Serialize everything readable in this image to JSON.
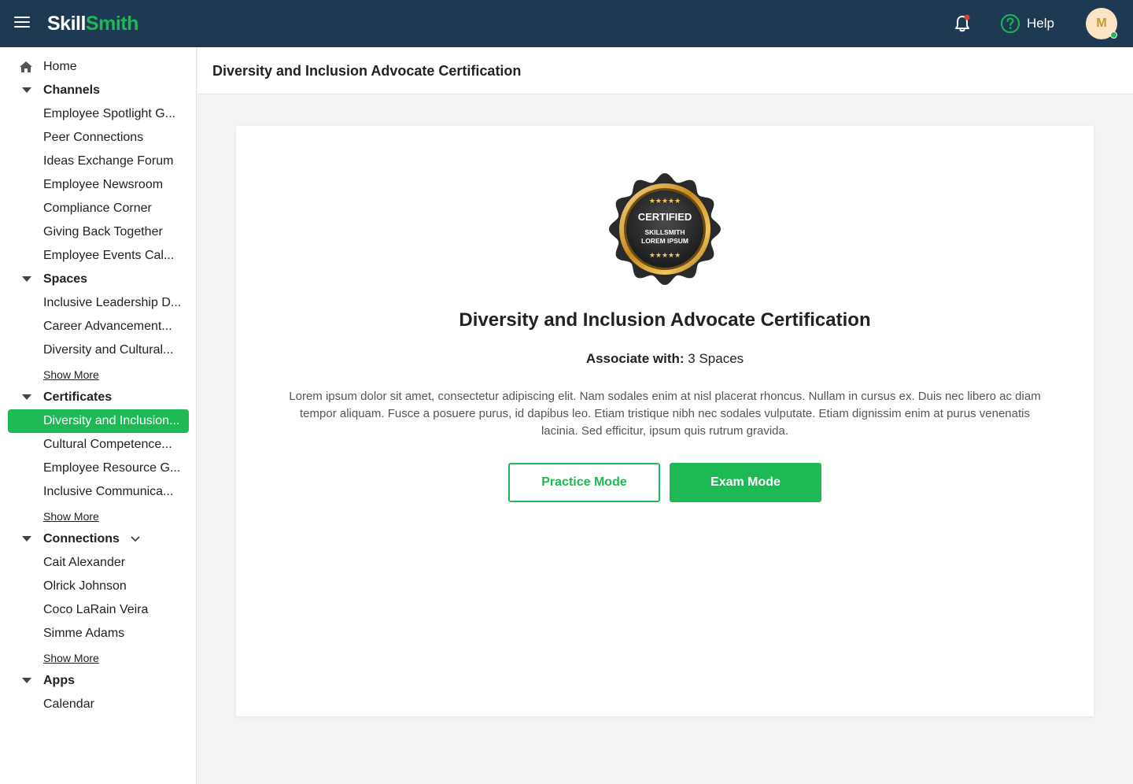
{
  "app": {
    "logo_part1": "Skill",
    "logo_part2": "Smith",
    "help_label": "Help",
    "avatar_initial": "M",
    "brand_color": "#1db954",
    "topbar_color": "#1e3a52"
  },
  "sidebar": {
    "home": "Home",
    "channels": {
      "label": "Channels",
      "items": [
        "Employee Spotlight G...",
        "Peer Connections",
        "Ideas Exchange Forum",
        "Employee Newsroom",
        "Compliance Corner",
        "Giving Back Together",
        "Employee Events Cal..."
      ]
    },
    "spaces": {
      "label": "Spaces",
      "items": [
        "Inclusive Leadership D...",
        "Career Advancement...",
        "Diversity and Cultural..."
      ],
      "show_more": "Show More"
    },
    "certificates": {
      "label": "Certificates",
      "items": [
        "Diversity and Inclusion...",
        "Cultural Competence...",
        "Employee Resource G...",
        "Inclusive Communica..."
      ],
      "show_more": "Show More"
    },
    "connections": {
      "label": "Connections",
      "items": [
        "Cait Alexander",
        "Olrick Johnson",
        "Coco LaRain Veira",
        "Simme Adams"
      ],
      "show_more": "Show More"
    },
    "apps": {
      "label": "Apps",
      "items": [
        "Calendar"
      ]
    }
  },
  "main": {
    "header_title": "Diversity and Inclusion Advocate Certification",
    "badge": {
      "line1": "CERTIFIED",
      "line2": "SKILLSMITH",
      "line3": "LOREM IPSUM",
      "stars": "★★★★★"
    },
    "card_title": "Diversity and Inclusion Advocate Certification",
    "associate_label": "Associate with:",
    "associate_value": "3 Spaces",
    "description": "Lorem ipsum dolor sit amet, consectetur adipiscing elit. Nam sodales enim at nisl placerat rhoncus. Nullam in cursus ex. Duis nec libero ac diam tempor aliquam. Fusce a posuere purus, id dapibus leo. Etiam tristique nibh nec sodales vulputate. Etiam dignissim enim at purus venenatis lacinia. Sed efficitur, ipsum quis rutrum gravida.",
    "practice_button": "Practice Mode",
    "exam_button": "Exam Mode"
  }
}
